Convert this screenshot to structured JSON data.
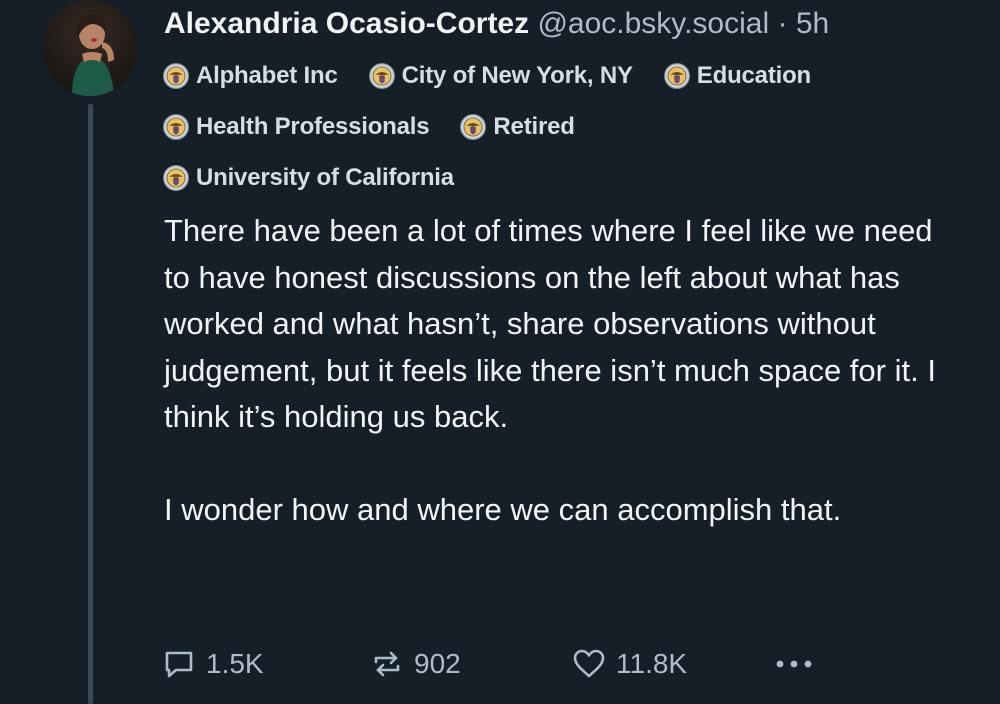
{
  "post": {
    "author": {
      "name": "Alexandria Ocasio-Cortez",
      "handle": "@aoc.bsky.social",
      "separator": "·",
      "time": "5h"
    },
    "labels": [
      [
        "Alphabet Inc",
        "City of New York, NY",
        "Education"
      ],
      [
        "Health Professionals",
        "Retired"
      ],
      [
        "University of California"
      ]
    ],
    "text": {
      "paragraph_1": "There have been a lot of times where I feel like we need to have honest discussions on the left about what has worked and what hasn’t, share observations without judgement, but it feels like there isn’t much space for it. I think it’s holding us back.",
      "paragraph_2": "I wonder how and where we can accomplish that."
    },
    "stats": {
      "replies": "1.5K",
      "reposts": "902",
      "likes": "11.8K"
    }
  },
  "icons": {
    "label": "seal-icon",
    "reply": "reply-icon",
    "repost": "repost-icon",
    "like": "heart-icon",
    "more": "more-icon"
  },
  "colors": {
    "background": "#161e27",
    "text": "#f1f3f5",
    "muted": "#aebbc9",
    "thread_line": "#3b4856"
  }
}
